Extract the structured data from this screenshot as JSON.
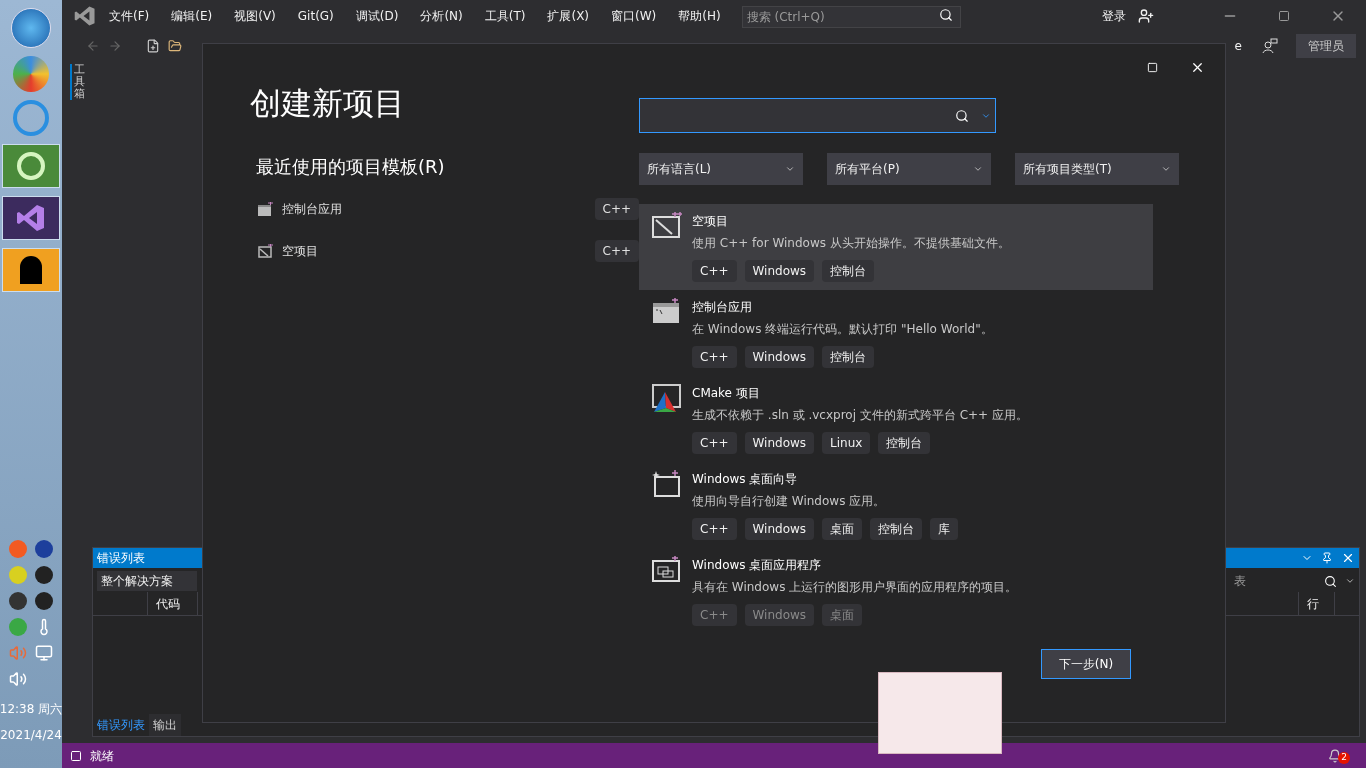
{
  "menu": [
    "文件(F)",
    "编辑(E)",
    "视图(V)",
    "Git(G)",
    "调试(D)",
    "分析(N)",
    "工具(T)",
    "扩展(X)",
    "窗口(W)",
    "帮助(H)"
  ],
  "search": {
    "placeholder": "搜索 (Ctrl+Q)"
  },
  "account": {
    "sign_in": "登录",
    "admin": "管理员"
  },
  "toolbar_partial": "e",
  "toolbox_label": "工具箱",
  "dialog": {
    "title": "创建新项目",
    "recent_heading": "最近使用的项目模板(R)",
    "recent": [
      {
        "name": "控制台应用",
        "tag": "C++",
        "kind": "console"
      },
      {
        "name": "空项目",
        "tag": "C++",
        "kind": "empty"
      }
    ],
    "filters": [
      "所有语言(L)",
      "所有平台(P)",
      "所有项目类型(T)"
    ],
    "templates": [
      {
        "name": "空项目",
        "description": "使用 C++ for Windows 从头开始操作。不提供基础文件。",
        "tags": [
          "C++",
          "Windows",
          "控制台"
        ],
        "kind": "empty",
        "selected": true,
        "dimmed": false
      },
      {
        "name": "控制台应用",
        "description": "在 Windows 终端运行代码。默认打印 \"Hello World\"。",
        "tags": [
          "C++",
          "Windows",
          "控制台"
        ],
        "kind": "console",
        "selected": false,
        "dimmed": false
      },
      {
        "name": "CMake 项目",
        "description": "生成不依赖于 .sln 或 .vcxproj 文件的新式跨平台 C++ 应用。",
        "tags": [
          "C++",
          "Windows",
          "Linux",
          "控制台"
        ],
        "kind": "cmake",
        "selected": false,
        "dimmed": false
      },
      {
        "name": "Windows 桌面向导",
        "description": "使用向导自行创建 Windows 应用。",
        "tags": [
          "C++",
          "Windows",
          "桌面",
          "控制台",
          "库"
        ],
        "kind": "wizard",
        "selected": false,
        "dimmed": false
      },
      {
        "name": "Windows 桌面应用程序",
        "description": "具有在 Windows 上运行的图形用户界面的应用程序的项目。",
        "tags": [
          "C++",
          "Windows",
          "桌面"
        ],
        "kind": "desktop",
        "selected": false,
        "dimmed": true
      }
    ],
    "next_button": "下一步(N)"
  },
  "error_list": {
    "title": "错误列表",
    "scope": "整个解决方案",
    "search_partial": "表",
    "columns": [
      "代码",
      "行"
    ],
    "tabs": [
      {
        "label": "错误列表",
        "selected": true
      },
      {
        "label": "输出",
        "selected": false
      }
    ]
  },
  "status": {
    "text": "就绪",
    "notifications": "2"
  },
  "taskbar": {
    "time": "12:38 周六",
    "date": "2021/4/24"
  }
}
